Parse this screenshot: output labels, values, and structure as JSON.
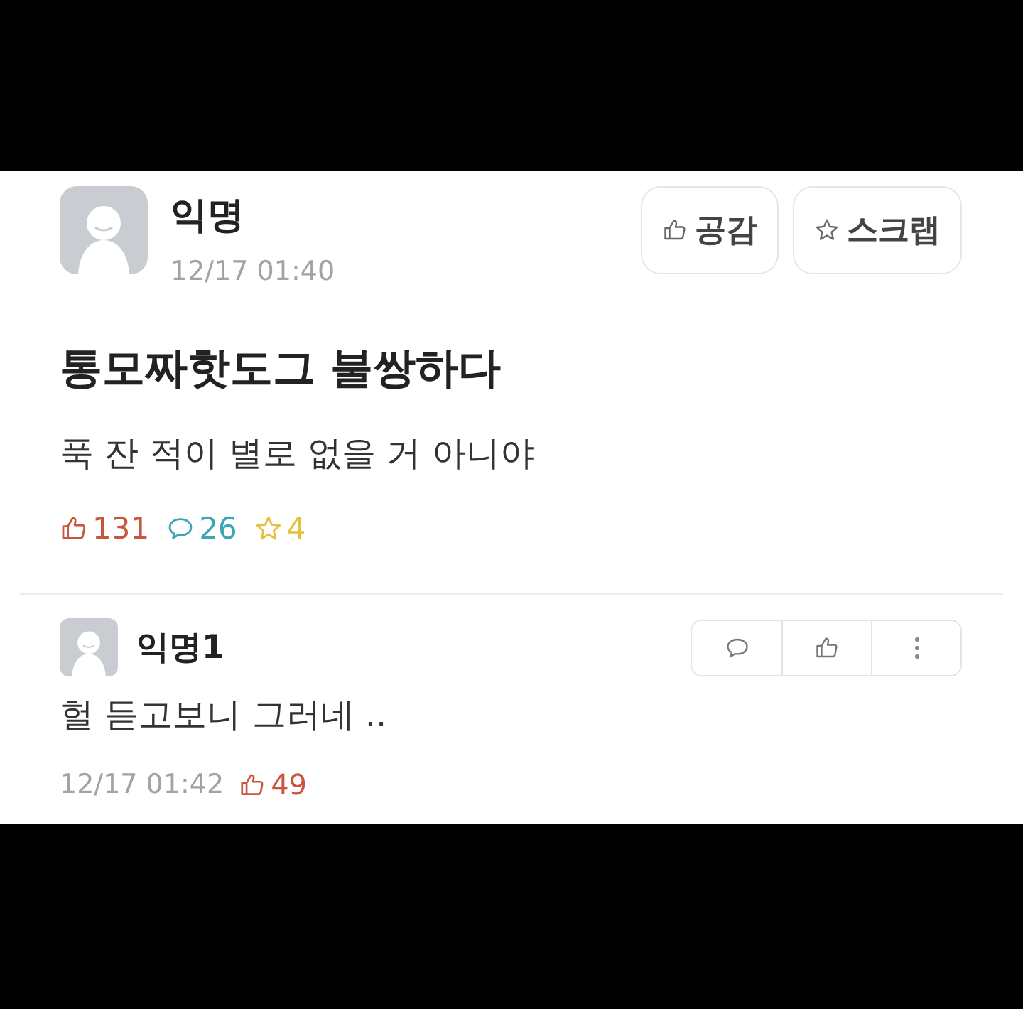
{
  "post": {
    "author": "익명",
    "time": "12/17 01:40",
    "buttons": [
      {
        "kind": "like",
        "label": "공감"
      },
      {
        "kind": "scrap",
        "label": "스크랩"
      }
    ],
    "title": "통모짜핫도그 불쌍하다",
    "body": "푹 잔 적이 별로 없을 거 아니야",
    "stats": [
      {
        "kind": "like",
        "count": "131",
        "color": "#c9553f"
      },
      {
        "kind": "comment",
        "count": "26",
        "color": "#3ba6b6"
      },
      {
        "kind": "scrap",
        "count": "4",
        "color": "#e2c23c"
      }
    ]
  },
  "comments": [
    {
      "author": "익명1",
      "text": "헐 듣고보니 그러네 ..",
      "time": "12/17 01:42",
      "likes": "49",
      "actions": [
        {
          "kind": "reply"
        },
        {
          "kind": "like"
        },
        {
          "kind": "more"
        }
      ]
    }
  ]
}
